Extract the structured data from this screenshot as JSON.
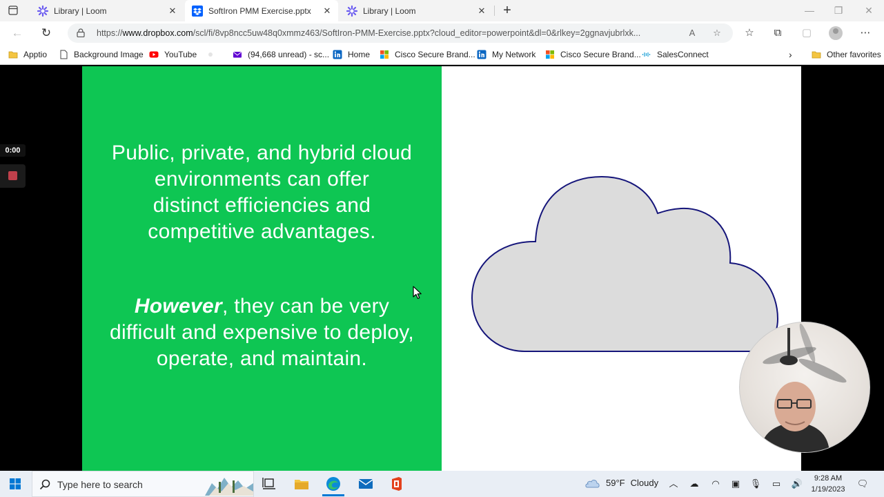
{
  "browser": {
    "tabs": [
      {
        "title": "Library | Loom",
        "active": false,
        "icon": "loom-icon"
      },
      {
        "title": "SoftIron PMM Exercise.pptx",
        "active": true,
        "icon": "dropbox-icon"
      },
      {
        "title": "Library | Loom",
        "active": false,
        "icon": "loom-icon"
      }
    ],
    "new_tab_label": "+",
    "url_prefix": "https://",
    "url_domain": "www.dropbox.com",
    "url_path": "/scl/fi/8vp8ncc5uw48q0xmmz463/SoftIron-PMM-Exercise.pptx?cloud_editor=powerpoint&dl=0&rlkey=2ggnavjubrlxk..."
  },
  "bookmarks": {
    "items": [
      {
        "label": "Apptio",
        "icon": "folder-icon"
      },
      {
        "label": "Background Image",
        "icon": "page-icon"
      },
      {
        "label": "YouTube",
        "icon": "youtube-icon"
      },
      {
        "label": "",
        "icon": "blank-icon"
      },
      {
        "label": "(94,668 unread) - sc...",
        "icon": "yahoo-mail-icon"
      },
      {
        "label": "Home",
        "icon": "linkedin-icon"
      },
      {
        "label": "Cisco Secure Brand...",
        "icon": "microsoft-icon"
      },
      {
        "label": "My Network",
        "icon": "linkedin-icon"
      },
      {
        "label": "Cisco Secure Brand...",
        "icon": "microsoft-icon"
      },
      {
        "label": "SalesConnect",
        "icon": "cisco-icon"
      }
    ],
    "other_favorites": "Other favorites"
  },
  "slide": {
    "paragraph1": [
      "Public, private, and hybrid cloud",
      "environments can offer",
      "distinct efficiencies and",
      "competitive advantages."
    ],
    "paragraph2_emphasis": "However",
    "paragraph2_line1_rest": ", they can be very",
    "paragraph2_lines": [
      "difficult and expensive to deploy,",
      "operate, and maintain."
    ],
    "left_color": "#0ec653",
    "cloud_fill": "#dcdcdc",
    "cloud_stroke": "#15157a"
  },
  "loom": {
    "timer": "0:00",
    "stop_color": "#c0404b"
  },
  "taskbar": {
    "search_placeholder": "Type here to search",
    "weather_temp": "59°F",
    "weather_desc": "Cloudy",
    "time": "9:28 AM",
    "date": "1/19/2023"
  }
}
